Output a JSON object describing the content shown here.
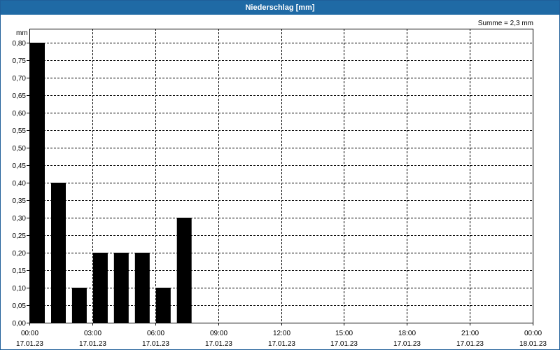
{
  "window": {
    "title": "Niederschlag [mm]"
  },
  "chart_data": {
    "type": "bar",
    "title": "Niederschlag [mm]",
    "ylabel": "mm",
    "annotation": "Summe = 2,3 mm",
    "ylim": [
      0,
      0.8
    ],
    "yticks": [
      "0,00",
      "0,05",
      "0,10",
      "0,15",
      "0,20",
      "0,25",
      "0,30",
      "0,35",
      "0,40",
      "0,45",
      "0,50",
      "0,55",
      "0,60",
      "0,65",
      "0,70",
      "0,75",
      "0,80"
    ],
    "xlim_hours": [
      0,
      24
    ],
    "xticks": [
      {
        "time": "00:00",
        "date": "17.01.23"
      },
      {
        "time": "03:00",
        "date": "17.01.23"
      },
      {
        "time": "06:00",
        "date": "17.01.23"
      },
      {
        "time": "09:00",
        "date": "17.01.23"
      },
      {
        "time": "12:00",
        "date": "17.01.23"
      },
      {
        "time": "15:00",
        "date": "17.01.23"
      },
      {
        "time": "18:00",
        "date": "17.01.23"
      },
      {
        "time": "21:00",
        "date": "17.01.23"
      },
      {
        "time": "00:00",
        "date": "18.01.23"
      }
    ],
    "grid": true,
    "bar_color": "#000000",
    "bars": [
      {
        "start": "00:00",
        "end": "01:00",
        "value": 0.8
      },
      {
        "start": "01:00",
        "end": "02:00",
        "value": 0.4
      },
      {
        "start": "02:00",
        "end": "03:00",
        "value": 0.1
      },
      {
        "start": "03:00",
        "end": "04:00",
        "value": 0.2
      },
      {
        "start": "04:00",
        "end": "05:00",
        "value": 0.2
      },
      {
        "start": "05:00",
        "end": "06:00",
        "value": 0.2
      },
      {
        "start": "06:00",
        "end": "07:00",
        "value": 0.1
      },
      {
        "start": "07:00",
        "end": "08:00",
        "value": 0.3
      }
    ]
  }
}
